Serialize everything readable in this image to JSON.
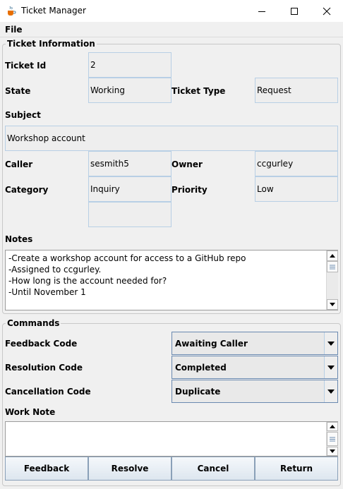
{
  "window": {
    "title": "Ticket Manager",
    "icon": "java-cup-icon",
    "controls": [
      "minimize-icon",
      "maximize-icon",
      "close-icon"
    ]
  },
  "menu": {
    "file": "File"
  },
  "ticket_info": {
    "legend": "Ticket Information",
    "ticket_id_label": "Ticket Id",
    "ticket_id": "2",
    "state_label": "State",
    "state": "Working",
    "ticket_type_label": "Ticket Type",
    "ticket_type": "Request",
    "subject_label": "Subject",
    "subject": "Workshop account",
    "caller_label": "Caller",
    "caller": "sesmith5",
    "owner_label": "Owner",
    "owner": "ccgurley",
    "category_label": "Category",
    "category": "Inquiry",
    "priority_label": "Priority",
    "priority": "Low",
    "extra_field": "",
    "notes_label": "Notes",
    "notes": "-Create a workshop account for access to a GitHub repo\n-Assigned to ccgurley.\n-How long is the account needed for?\n-Until November 1"
  },
  "commands": {
    "legend": "Commands",
    "feedback_code_label": "Feedback Code",
    "feedback_code": "Awaiting Caller",
    "resolution_code_label": "Resolution Code",
    "resolution_code": "Completed",
    "cancellation_code_label": "Cancellation Code",
    "cancellation_code": "Duplicate",
    "work_note_label": "Work Note",
    "work_note": ""
  },
  "buttons": {
    "feedback": "Feedback",
    "resolve": "Resolve",
    "cancel": "Cancel",
    "return": "Return"
  }
}
